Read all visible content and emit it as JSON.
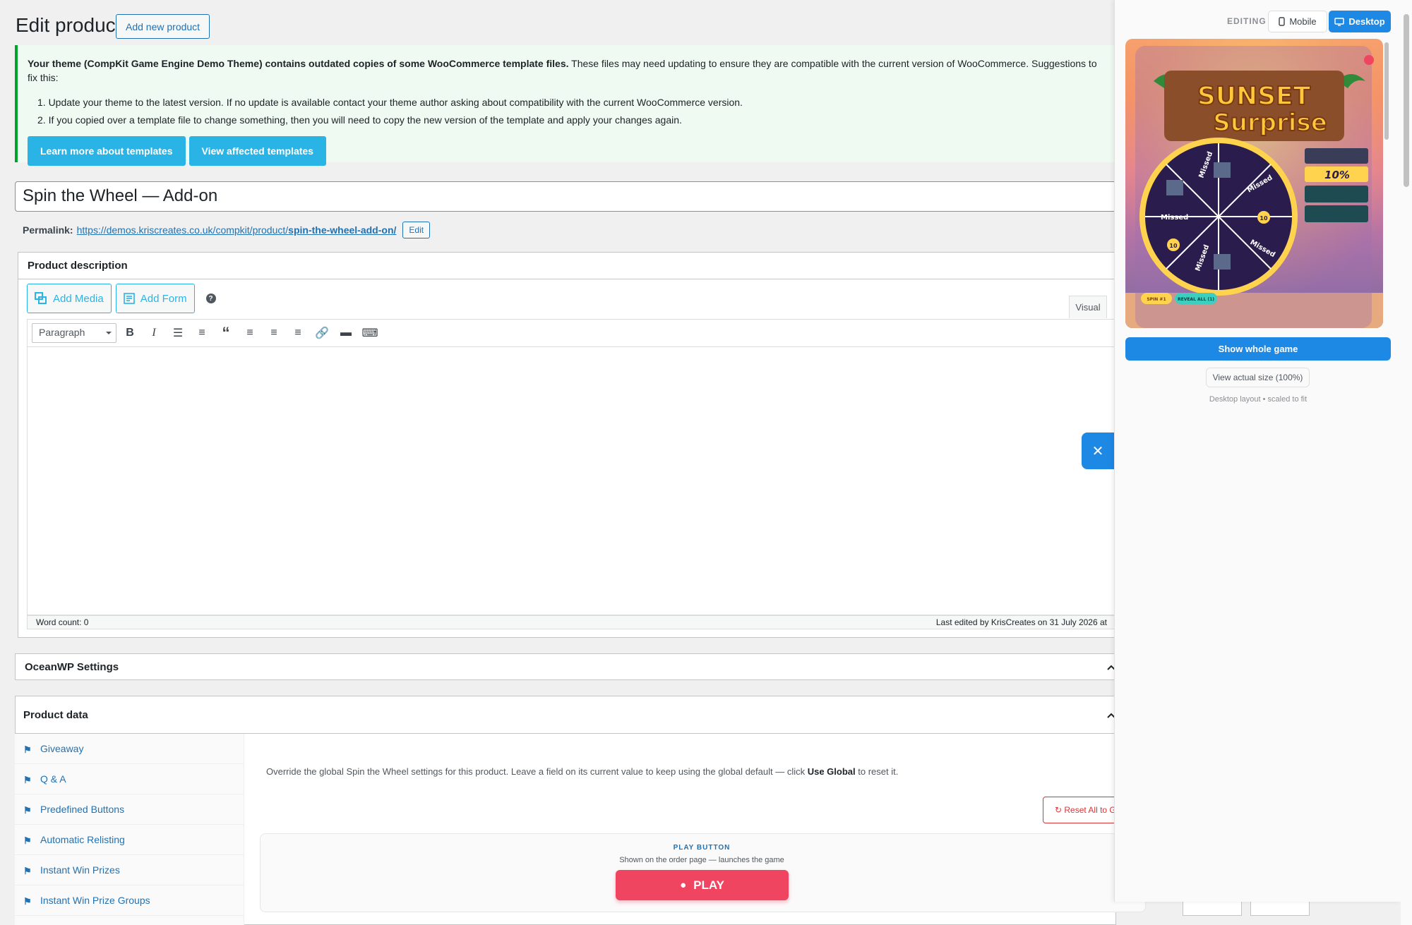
{
  "header": {
    "title": "Edit product",
    "add_new": "Add new product"
  },
  "notice": {
    "bold": "Your theme (CompKit Game Engine Demo Theme) contains outdated copies of some WooCommerce template files.",
    "rest": " These files may need updating to ensure they are compatible with the current version of WooCommerce. Suggestions to fix this:",
    "items": [
      "1. Update your theme to the latest version. If no update is available contact your theme author asking about compatibility with the current WooCommerce version.",
      "2. If you copied over a template file to change something, then you will need to copy the new version of the template and apply your changes again."
    ],
    "btn_learn": "Learn more about templates",
    "btn_view": "View affected templates"
  },
  "product": {
    "title": "Spin the Wheel — Add-on",
    "permalink_label": "Permalink:",
    "permalink_base": "https://demos.kriscreates.co.uk/compkit/product/",
    "permalink_slug": "spin-the-wheel-add-on/",
    "permalink_edit": "Edit"
  },
  "description": {
    "heading": "Product description",
    "add_media": "Add Media",
    "add_form": "Add Form",
    "help": "?",
    "visual_tab": "Visual",
    "format": "Paragraph",
    "word_count": "Word count: 0",
    "last_edited": "Last edited by KrisCreates on 31 July 2026 at"
  },
  "ocean": {
    "heading": "OceanWP Settings"
  },
  "product_data": {
    "heading": "Product data",
    "tabs": [
      "Giveaway",
      "Q & A",
      "Predefined Buttons",
      "Automatic Relisting",
      "Instant Win Prizes",
      "Instant Win Prize Groups"
    ],
    "override_text_a": "Override the global Spin the Wheel settings for this product. Leave a field on its current value to keep using the global default — click ",
    "override_bold": "Use Global",
    "override_text_b": " to reset it.",
    "reset_label": "↻ Reset All to G",
    "play_label": "PLAY BUTTON",
    "play_sub": "Shown on the order page — launches the game",
    "play_btn": "PLAY"
  },
  "panel": {
    "editing": "EDITING",
    "mobile": "Mobile",
    "desktop": "Desktop",
    "show_whole": "Show whole game",
    "actual_size": "View actual size (100%)",
    "layout_note": "Desktop layout • scaled to fit",
    "game_title_1": "SUNSET",
    "game_title_2": "Surprise",
    "wheel_missed": "Missed",
    "wheel_ten": "10",
    "prize_pct": "10%",
    "chip_spin": "SPIN #1",
    "chip_reveal": "REVEAL ALL (1)"
  },
  "colors": {
    "accent": "#1e88e5",
    "notice_btn": "#2ab4e6",
    "play": "#f04561",
    "success": "#00a32a"
  }
}
